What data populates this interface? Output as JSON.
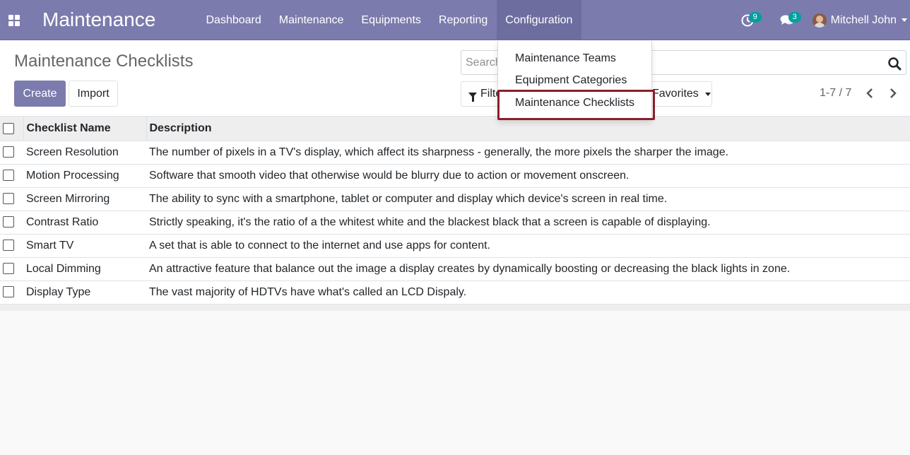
{
  "navbar": {
    "app_title": "Maintenance",
    "menu": [
      {
        "label": "Dashboard"
      },
      {
        "label": "Maintenance"
      },
      {
        "label": "Equipments"
      },
      {
        "label": "Reporting"
      },
      {
        "label": "Configuration",
        "active": true
      }
    ],
    "activity_count": "9",
    "message_count": "3",
    "user_name": "Mitchell John",
    "color": "#7c7bad"
  },
  "control_panel": {
    "page_title": "Maintenance Checklists",
    "create_label": "Create",
    "import_label": "Import",
    "search_placeholder": "Search...",
    "filters_label": "Filters",
    "favorites_label": "Favorites",
    "pager": "1-7 / 7"
  },
  "config_dropdown": {
    "items": [
      {
        "label": "Maintenance Teams"
      },
      {
        "label": "Equipment Categories"
      },
      {
        "label": "Maintenance Checklists",
        "highlighted": true
      }
    ]
  },
  "list": {
    "columns": [
      "Checklist Name",
      "Description"
    ],
    "rows": [
      {
        "name": "Screen Resolution",
        "description": "The number of pixels in a TV's display, which affect its sharpness - generally, the more pixels the sharper the image."
      },
      {
        "name": "Motion Processing",
        "description": "Software that smooth video that otherwise would be blurry due to action or movement onscreen."
      },
      {
        "name": "Screen Mirroring",
        "description": "The ability to sync with a smartphone, tablet or computer and display which device's screen in real time."
      },
      {
        "name": "Contrast Ratio",
        "description": "Strictly speaking, it's the ratio of a the whitest white and the blackest black that a screen is capable of displaying."
      },
      {
        "name": "Smart TV",
        "description": "A set that is able to connect to the internet and use apps for content."
      },
      {
        "name": "Local Dimming",
        "description": "An attractive feature that balance out the image a display creates by dynamically boosting or decreasing the black lights in zone."
      },
      {
        "name": "Display Type",
        "description": "The vast majority of HDTVs have what's called an LCD Dispaly."
      }
    ]
  }
}
